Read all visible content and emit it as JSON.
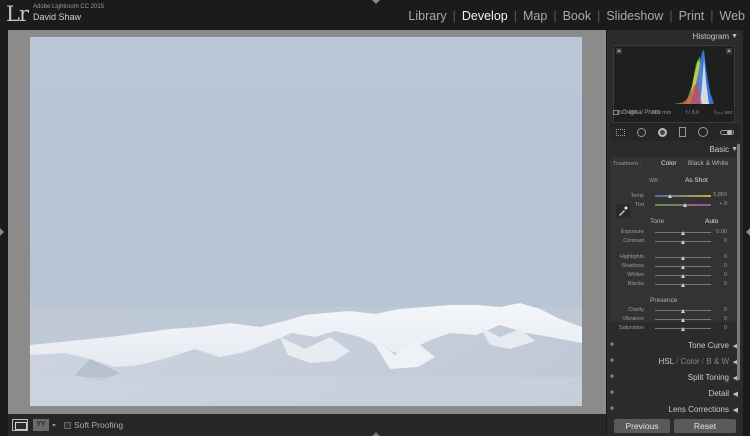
{
  "app": {
    "logo": "Lr",
    "product": "Adobe Lightroom CC 2015",
    "user": "David Shaw"
  },
  "modules": [
    {
      "label": "Library",
      "active": false
    },
    {
      "label": "Develop",
      "active": true
    },
    {
      "label": "Map",
      "active": false
    },
    {
      "label": "Slideshow",
      "active": false
    },
    {
      "label": "Print",
      "active": false
    },
    {
      "label": "Web",
      "active": false
    }
  ],
  "modules_book": "Book",
  "histogram": {
    "title": "Histogram",
    "iso": "ISO 400",
    "focal": "200 mm",
    "aperture": "f / 8.0",
    "shutter": "¹⁄₂₅₀ sec",
    "original_photo": "Original Photo"
  },
  "basic": {
    "title": "Basic",
    "treatment_label": "Treatment :",
    "treatment_color": "Color",
    "treatment_bw": "Black & White",
    "wb_label": "WB :",
    "wb_value": "As Shot",
    "temp_label": "Temp",
    "temp_value": "5,850",
    "tint_label": "Tint",
    "tint_value": "+ 9",
    "tone_label": "Tone",
    "auto_label": "Auto",
    "exposure_label": "Exposure",
    "exposure_value": "0.00",
    "contrast_label": "Contrast",
    "contrast_value": "0",
    "highlights_label": "Highlights",
    "highlights_value": "0",
    "shadows_label": "Shadows",
    "shadows_value": "0",
    "whites_label": "Whites",
    "whites_value": "0",
    "blacks_label": "Blacks",
    "blacks_value": "0",
    "presence_label": "Presence",
    "clarity_label": "Clarity",
    "clarity_value": "0",
    "vibrance_label": "Vibrance",
    "vibrance_value": "0",
    "saturation_label": "Saturation",
    "saturation_value": "0"
  },
  "panels": {
    "tone_curve": "Tone Curve",
    "hsl": "HSL",
    "slash1": "/",
    "color": "Color",
    "slash2": "/",
    "bw": "B & W",
    "split_toning": "Split Toning",
    "detail": "Detail",
    "lens_corrections": "Lens Corrections"
  },
  "toolbar": {
    "soft_proofing": "Soft Proofing",
    "compare_glyph": "YY"
  },
  "buttons": {
    "previous": "Previous",
    "reset": "Reset"
  },
  "colors": {
    "accent_active": "#f2f2f2",
    "panel_bg": "#2b2b2b",
    "canvas_bg": "#8b8b8b"
  }
}
